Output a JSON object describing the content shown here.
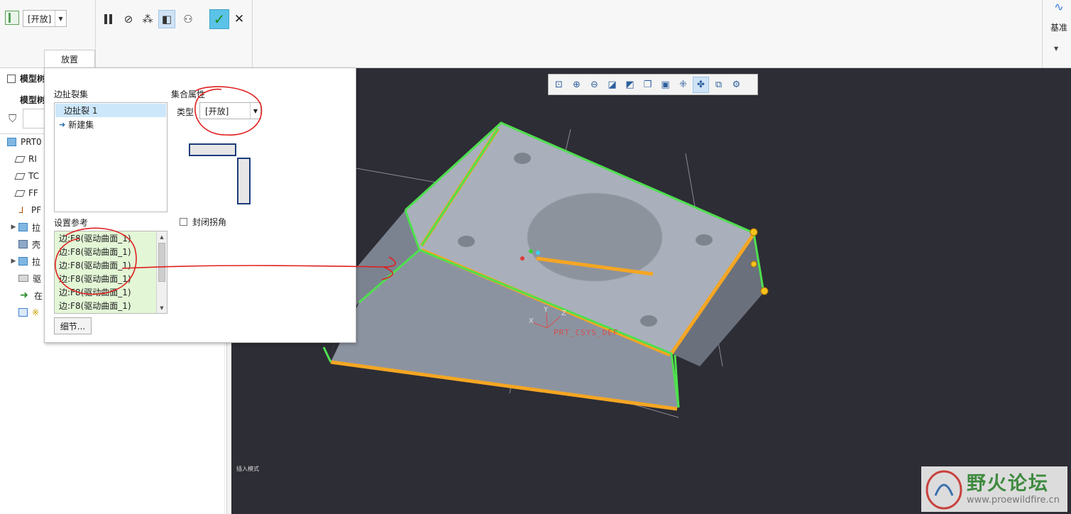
{
  "ribbon": {
    "type_value": "[开放]",
    "placement_tab": "放置",
    "datum_label": "基准"
  },
  "model_tree": {
    "header": "模型树",
    "subheader": "模型树",
    "rows": [
      {
        "label": "PRT0",
        "icon": "part-icon"
      },
      {
        "label": "RI",
        "icon": "datum-plane-icon"
      },
      {
        "label": "TC",
        "icon": "datum-plane-icon"
      },
      {
        "label": "FF",
        "icon": "datum-plane-icon"
      },
      {
        "label": "PF",
        "icon": "csys-icon"
      },
      {
        "label": "拉",
        "icon": "extrude-icon"
      },
      {
        "label": "壳",
        "icon": "shell-icon"
      },
      {
        "label": "拉",
        "icon": "extrude-icon"
      },
      {
        "label": "驱",
        "icon": "driving-surface-icon"
      },
      {
        "label": "在",
        "icon": "insert-here-icon"
      },
      {
        "label": "※",
        "icon": "edge-rip-icon"
      }
    ]
  },
  "panel": {
    "rip_sets_label": "边扯裂集",
    "rip_sets": [
      "边扯裂 1",
      "新建集"
    ],
    "set_props_label": "集合属性",
    "type_label": "类型",
    "type_value": "[开放]",
    "close_corner_label": "封闭拐角",
    "close_corner_checked": false,
    "refs_label": "设置参考",
    "references": [
      "边:F8(驱动曲面_1)",
      "边:F8(驱动曲面_1)",
      "边:F8(驱动曲面_1)",
      "边:F8(驱动曲面_1)",
      "边:F8(驱动曲面_1)",
      "边:F8(驱动曲面_1)"
    ],
    "details_button": "细节..."
  },
  "viewport": {
    "csys_label": "PRT_CSYS_DEF",
    "axis_x": "X",
    "axis_y": "Y",
    "axis_z": "Z",
    "status_note": "插入模式",
    "background_color": "#2d2d35",
    "highlight_color": "#4ee04e",
    "selected_edge_color": "#f5a623"
  },
  "watermark": {
    "title": "野火论坛",
    "url": "www.proewildfire.cn"
  },
  "colors": {
    "annotation_red": "#e02020",
    "selection_blue": "#cce7fa",
    "reference_green": "#e3f7d6"
  }
}
